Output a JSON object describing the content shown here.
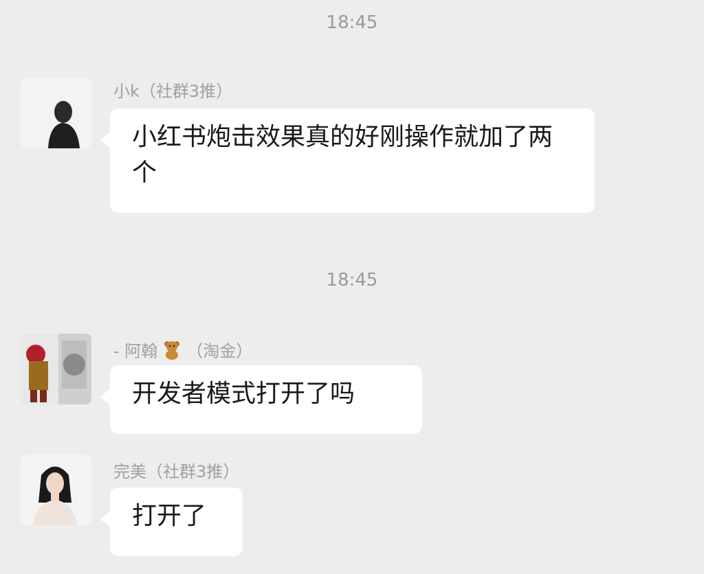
{
  "chat": {
    "messages": [
      {
        "timestamp": "18:45",
        "sender": "小k（社群3推）",
        "text": "小红书炮击效果真的好刚操作就加了两个",
        "avatar": "person-silhouette-avatar"
      },
      {
        "timestamp": "18:45",
        "sender_prefix": "- 阿翰",
        "sender_suffix": "（淘金）",
        "text": "开发者模式打开了吗",
        "avatar": "figure-collage-avatar"
      },
      {
        "sender": "完美（社群3推）",
        "text": "打开了",
        "avatar": "girl-portrait-avatar"
      }
    ]
  },
  "colors": {
    "background": "#ededed",
    "bubble": "#ffffff",
    "meta_text": "#9a9a9a",
    "message_text": "#191919"
  }
}
